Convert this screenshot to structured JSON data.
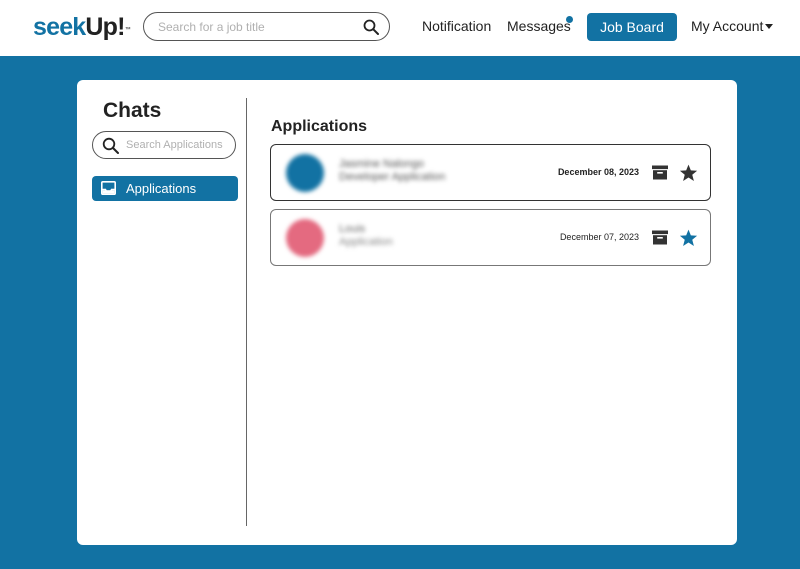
{
  "header": {
    "logo": {
      "part1": "seek",
      "part2": "Up!",
      "tm": "™"
    },
    "search": {
      "placeholder": "Search for a job title",
      "value": "",
      "icon": "search-icon"
    },
    "nav": {
      "notification": "Notification",
      "messages": "Messages",
      "messages_has_unread": true,
      "job_board": "Job Board",
      "my_account": "My Account"
    }
  },
  "sidebar": {
    "title": "Chats",
    "search": {
      "placeholder": "Search Applications",
      "value": "",
      "icon": "search-icon"
    },
    "items": [
      {
        "label": "Applications",
        "icon": "inbox-icon",
        "selected": true
      }
    ]
  },
  "main": {
    "heading": "Applications",
    "applications": [
      {
        "name": "Jasmine Nalongo",
        "subtitle": "Developer Application",
        "date": "December 08, 2023",
        "unread": true,
        "starred": false,
        "avatar_color": "#1272a3"
      },
      {
        "name": "Louis",
        "subtitle": "Application",
        "date": "December 07, 2023",
        "unread": false,
        "starred": true,
        "avatar_color": "#e46a80"
      }
    ]
  },
  "colors": {
    "brand": "#1272a3",
    "background": "#1272a3",
    "text": "#222222",
    "star_inactive": "#333333",
    "star_active": "#1272a3"
  }
}
